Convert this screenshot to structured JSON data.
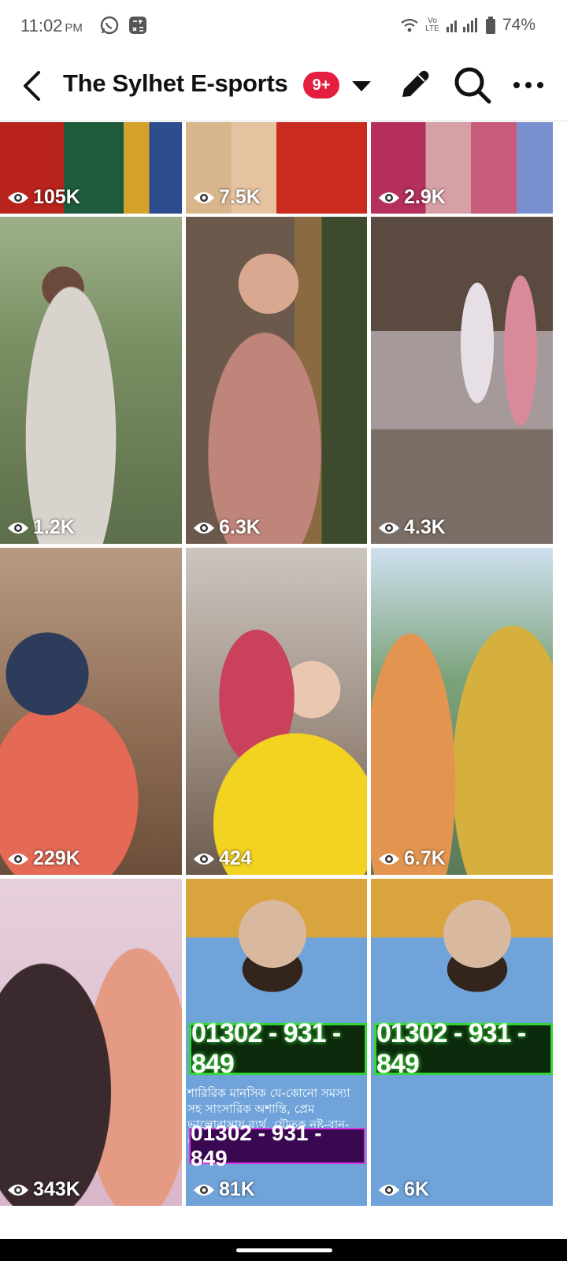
{
  "status": {
    "time": "11:02",
    "ampm": "PM",
    "network_label": "Vo LTE",
    "battery": "74%"
  },
  "header": {
    "title": "The Sylhet E-sports",
    "notification_badge": "9+",
    "icons": [
      "back-icon",
      "caret-down-icon",
      "edit-icon",
      "search-icon",
      "more-icon"
    ]
  },
  "grid": {
    "videos": [
      {
        "views": "105K",
        "palette": [
          "#b8231b",
          "#1d5b3c",
          "#d4a12a"
        ]
      },
      {
        "views": "7.5K",
        "palette": [
          "#c92b1f",
          "#e6b57a",
          "#9c2a22"
        ]
      },
      {
        "views": "2.9K",
        "palette": [
          "#b52f5b",
          "#d7a0a7",
          "#5d2b45"
        ]
      },
      {
        "views": "1.2K",
        "palette": [
          "#7a8e63",
          "#d9d3ce",
          "#b9445d"
        ]
      },
      {
        "views": "6.3K",
        "palette": [
          "#6b5a4b",
          "#c0857a",
          "#3d4a2e"
        ]
      },
      {
        "views": "4.3K",
        "palette": [
          "#5b4a40",
          "#a6999a",
          "#d98a9a"
        ]
      },
      {
        "views": "229K",
        "palette": [
          "#8b6a52",
          "#e46a55",
          "#2d3c5a"
        ]
      },
      {
        "views": "424",
        "palette": [
          "#f3d321",
          "#c9415a",
          "#e9c7b0"
        ]
      },
      {
        "views": "6.7K",
        "palette": [
          "#e3954f",
          "#d5b03e",
          "#7ba27a"
        ]
      },
      {
        "views": "343K",
        "palette": [
          "#d9b6c9",
          "#e59b83",
          "#3a2a2e"
        ]
      },
      {
        "views": "81K",
        "palette": [
          "#6fa3d9",
          "#d9a33e",
          "#33241c"
        ]
      },
      {
        "views": "6K",
        "palette": [
          "#6fa3d9",
          "#d9a33e",
          "#33241c"
        ]
      }
    ],
    "phone_banner": "01302 - 931 - 849",
    "bengali_caption": "শারিরিক মানসিক যে-কোনো সমস্যা সহ সাংসারিক অশান্তি, প্রেম ভালোবাসায় ব্যর্থ, যৌতুক নষ্ট-বান-টেনা, প্রবাসে যেতে সমস্যা,",
    "purple_banner": "01302 - 931 - 849"
  }
}
